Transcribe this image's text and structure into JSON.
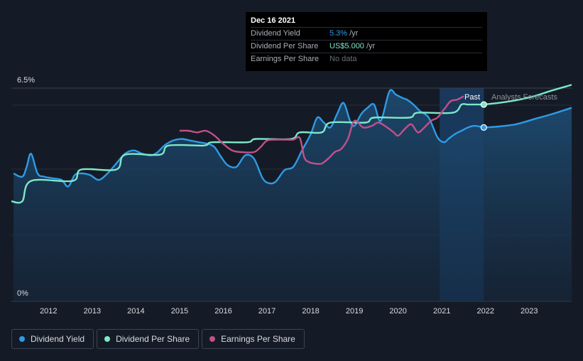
{
  "tooltip": {
    "date": "Dec 16 2021",
    "rows": [
      {
        "label": "Dividend Yield",
        "value": "5.3%",
        "unit": "/yr",
        "color": "#2e9be6"
      },
      {
        "label": "Dividend Per Share",
        "value": "US$5.000",
        "unit": "/yr",
        "color": "#7de8c8"
      },
      {
        "label": "Earnings Per Share",
        "value": "No data",
        "unit": "",
        "color": "#6b7079"
      }
    ]
  },
  "chart_data": {
    "type": "line",
    "ylim": [
      0,
      6.5
    ],
    "y_tick_labels": [
      "6.5%",
      "0%"
    ],
    "x_tick_labels": [
      "2012",
      "2013",
      "2014",
      "2015",
      "2016",
      "2017",
      "2018",
      "2019",
      "2020",
      "2021",
      "2022",
      "2023"
    ],
    "xlim": [
      2011.15,
      2023.97
    ],
    "past_label": "Past",
    "forecast_label": "Analysts Forecasts",
    "forecast_start": 2020.95,
    "today": 2021.96,
    "grid": true,
    "series": [
      {
        "name": "Dividend Yield",
        "color": "#2e9be6",
        "area": true,
        "x": [
          2011.2,
          2011.4,
          2011.5,
          2011.6,
          2011.75,
          2011.9,
          2012.1,
          2012.3,
          2012.45,
          2012.6,
          2012.75,
          2012.95,
          2013.15,
          2013.35,
          2013.55,
          2013.75,
          2013.95,
          2014.15,
          2014.35,
          2014.5,
          2014.65,
          2014.85,
          2015.05,
          2015.25,
          2015.45,
          2015.65,
          2015.8,
          2015.95,
          2016.1,
          2016.3,
          2016.5,
          2016.7,
          2016.9,
          2017.05,
          2017.2,
          2017.4,
          2017.6,
          2017.8,
          2018.0,
          2018.15,
          2018.3,
          2018.45,
          2018.6,
          2018.75,
          2018.9,
          2019.0,
          2019.15,
          2019.3,
          2019.45,
          2019.6,
          2019.8,
          2019.95,
          2020.1,
          2020.2,
          2020.35,
          2020.5,
          2020.7,
          2020.9,
          2021.05,
          2021.15,
          2021.3,
          2021.45,
          2021.6,
          2021.75,
          2021.96
        ],
        "y": [
          3.9,
          3.8,
          4.1,
          4.5,
          3.9,
          3.8,
          3.75,
          3.7,
          3.5,
          3.85,
          3.9,
          3.85,
          3.7,
          3.9,
          4.2,
          4.5,
          4.6,
          4.5,
          4.45,
          4.55,
          4.75,
          4.9,
          4.95,
          4.9,
          4.85,
          4.8,
          4.7,
          4.4,
          4.15,
          4.1,
          4.45,
          4.35,
          3.75,
          3.6,
          3.65,
          4.0,
          4.1,
          4.6,
          5.1,
          5.6,
          5.45,
          5.3,
          5.7,
          6.05,
          5.5,
          5.35,
          5.7,
          5.9,
          6.0,
          5.5,
          6.4,
          6.3,
          6.2,
          6.15,
          6.0,
          5.8,
          5.6,
          5.0,
          4.85,
          4.95,
          5.1,
          5.2,
          5.3,
          5.35,
          5.3
        ]
      },
      {
        "name": "Dividend Yield forecast",
        "color": "#2e9be6",
        "area": true,
        "x": [
          2021.96,
          2022.3,
          2022.7,
          2023.1,
          2023.5,
          2023.97
        ],
        "y": [
          5.3,
          5.33,
          5.4,
          5.55,
          5.7,
          5.9
        ]
      },
      {
        "name": "Dividend Per Share",
        "color": "#7de8c8",
        "x": [
          2011.15,
          2011.4,
          2011.6,
          2012.55,
          2012.75,
          2013.55,
          2013.75,
          2014.55,
          2014.75,
          2015.55,
          2015.75,
          2016.55,
          2016.75,
          2017.55,
          2017.75,
          2018.25,
          2018.45,
          2019.25,
          2019.45,
          2020.25,
          2020.45,
          2021.25,
          2021.45,
          2021.6,
          2021.8,
          2021.96
        ],
        "y": [
          3.05,
          3.05,
          3.67,
          3.67,
          4.02,
          4.02,
          4.47,
          4.47,
          4.75,
          4.75,
          4.85,
          4.85,
          4.95,
          4.95,
          5.15,
          5.15,
          5.45,
          5.45,
          5.6,
          5.6,
          5.75,
          5.75,
          6.0,
          6.0,
          6.0,
          6.0
        ]
      },
      {
        "name": "Dividend Per Share forecast",
        "color": "#7de8c8",
        "x": [
          2021.96,
          2022.3,
          2022.7,
          2023.1,
          2023.5,
          2023.97
        ],
        "y": [
          6.0,
          6.05,
          6.13,
          6.25,
          6.42,
          6.6
        ]
      },
      {
        "name": "Earnings Per Share",
        "color": "#c2508c",
        "x": [
          2015.0,
          2015.2,
          2015.4,
          2015.6,
          2015.8,
          2016.0,
          2016.2,
          2016.4,
          2016.7,
          2016.85,
          2017.0,
          2017.2,
          2017.4,
          2017.6,
          2017.75,
          2017.85,
          2017.95,
          2018.1,
          2018.25,
          2018.4,
          2018.55,
          2018.7,
          2018.85,
          2019.0,
          2019.2,
          2019.4,
          2019.55,
          2019.75,
          2019.9,
          2020.0,
          2020.15,
          2020.3,
          2020.45,
          2020.6,
          2020.75,
          2020.9,
          2021.05,
          2021.2,
          2021.35,
          2021.5
        ],
        "y": [
          5.2,
          5.2,
          5.15,
          5.2,
          5.05,
          4.8,
          4.6,
          4.55,
          4.55,
          4.7,
          4.9,
          4.93,
          4.93,
          4.93,
          4.98,
          4.4,
          4.25,
          4.2,
          4.2,
          4.35,
          4.55,
          4.65,
          4.95,
          5.5,
          5.3,
          5.35,
          5.45,
          5.3,
          5.15,
          5.05,
          5.25,
          5.4,
          5.15,
          5.3,
          5.5,
          5.6,
          5.85,
          6.1,
          6.15,
          6.25
        ]
      }
    ]
  },
  "legend": [
    {
      "label": "Dividend Yield",
      "color": "#2e9be6"
    },
    {
      "label": "Dividend Per Share",
      "color": "#7de8c8"
    },
    {
      "label": "Earnings Per Share",
      "color": "#c2508c"
    }
  ]
}
